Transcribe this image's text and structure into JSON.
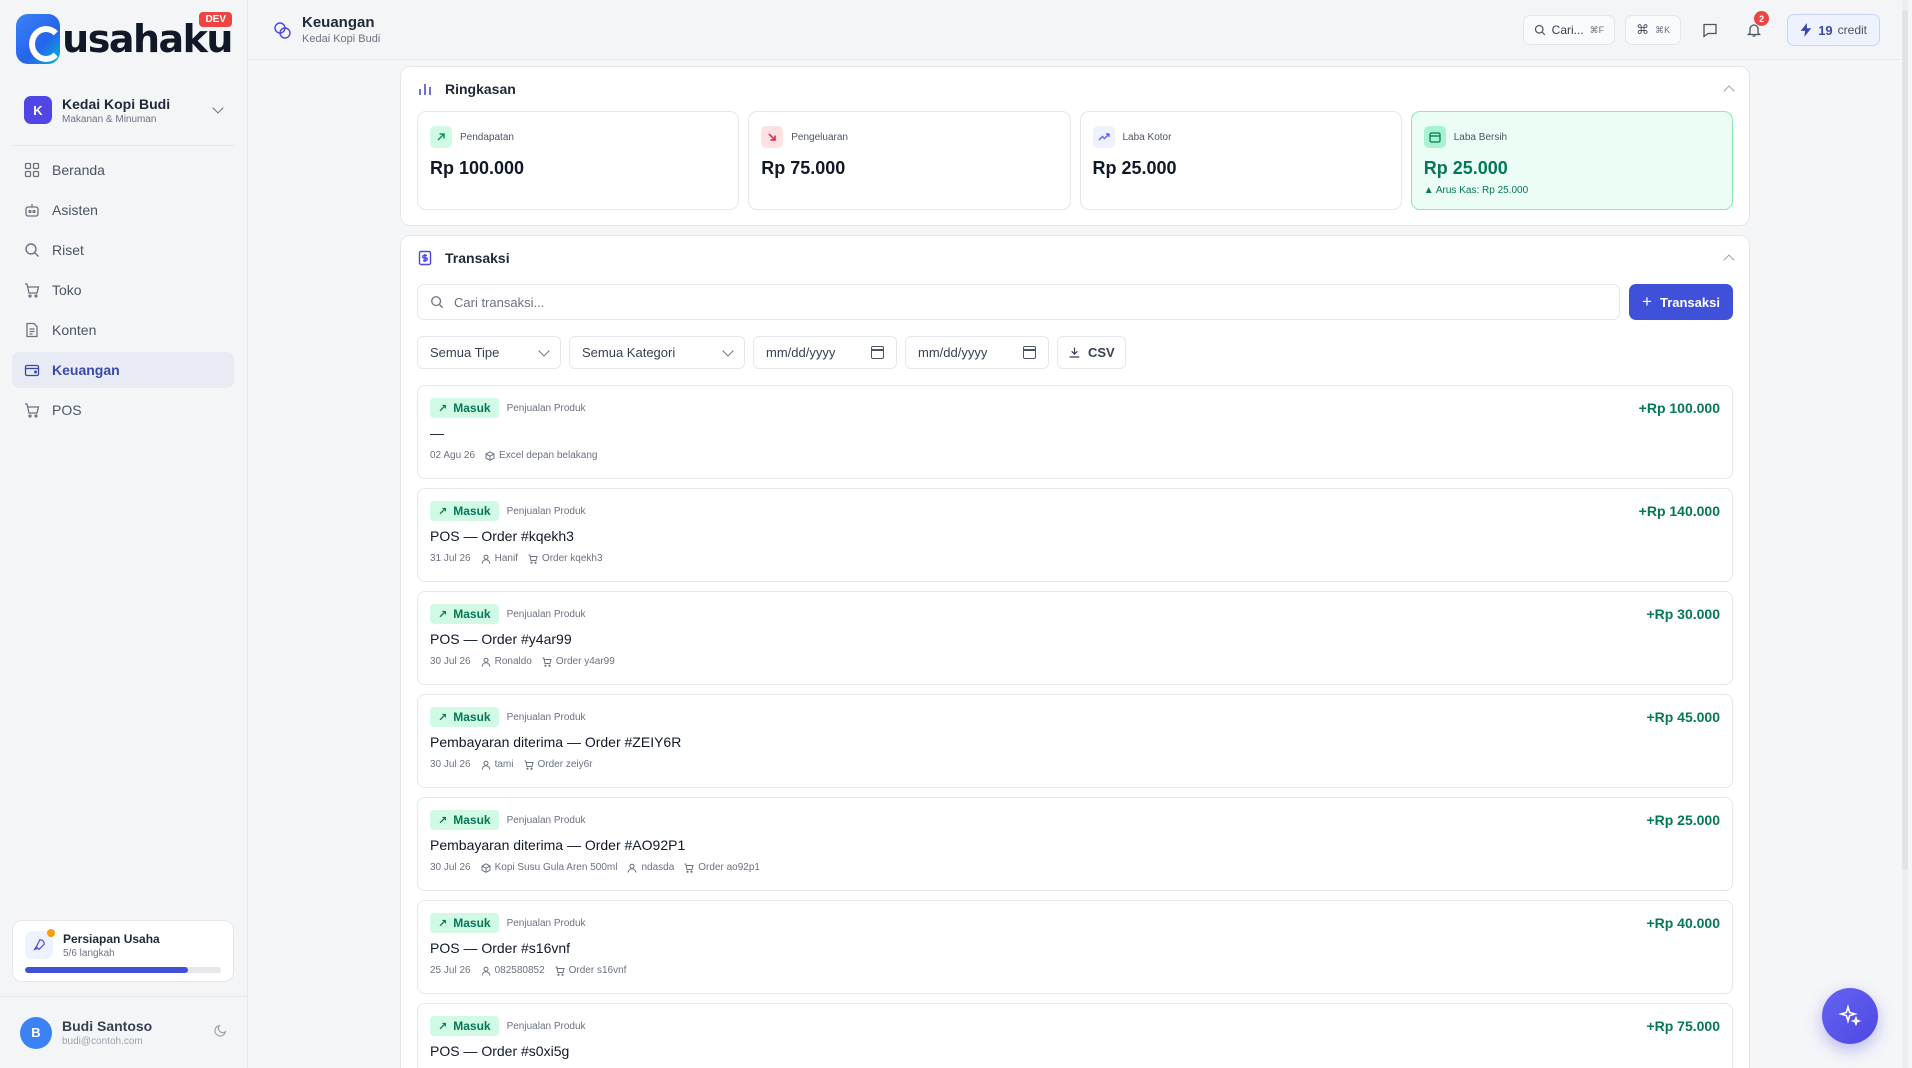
{
  "brand": {
    "name": "usahaku",
    "badge": "DEV"
  },
  "workspace": {
    "initial": "K",
    "name": "Kedai Kopi Budi",
    "category": "Makanan & Minuman"
  },
  "nav": [
    {
      "label": "Beranda",
      "icon": "dashboard-icon"
    },
    {
      "label": "Asisten",
      "icon": "bot-icon"
    },
    {
      "label": "Riset",
      "icon": "search-icon"
    },
    {
      "label": "Toko",
      "icon": "cart-icon"
    },
    {
      "label": "Konten",
      "icon": "document-icon"
    },
    {
      "label": "Keuangan",
      "icon": "wallet-icon",
      "active": true
    },
    {
      "label": "POS",
      "icon": "cart-icon"
    }
  ],
  "setup": {
    "title": "Persiapan Usaha",
    "steps": "5/6 langkah",
    "progress": 0.83
  },
  "user": {
    "initial": "B",
    "name": "Budi Santoso",
    "email": "budi@contoh.com"
  },
  "header": {
    "title": "Keuangan",
    "subtitle": "Kedai Kopi Budi"
  },
  "topbar": {
    "search_label": "Cari...",
    "search_kbd": "⌘F",
    "cmd_kbd": "⌘K",
    "notif_count": "2",
    "credit_count": "19",
    "credit_label": "credit"
  },
  "summary": {
    "title": "Ringkasan",
    "cards": [
      {
        "label": "Pendapatan",
        "value": "Rp 100.000"
      },
      {
        "label": "Pengeluaran",
        "value": "Rp 75.000"
      },
      {
        "label": "Laba Kotor",
        "value": "Rp 25.000"
      },
      {
        "label": "Laba Bersih",
        "value": "Rp 25.000",
        "note": "▲ Arus Kas: Rp 25.000"
      }
    ]
  },
  "transactions": {
    "title": "Transaksi",
    "search_placeholder": "Cari transaksi...",
    "add_label": "Transaksi",
    "filters": {
      "type": "Semua Tipe",
      "category": "Semua Kategori",
      "date_from": "mm/dd/yyyy",
      "date_to": "mm/dd/yyyy",
      "export": "CSV"
    },
    "items": [
      {
        "badge": "Masuk",
        "category": "Penjualan Produk",
        "title": "—",
        "amount": "+Rp 100.000",
        "date": "02 Agu 26",
        "meta": [
          {
            "icon": "box-icon",
            "text": "Excel depan belakang"
          }
        ]
      },
      {
        "badge": "Masuk",
        "category": "Penjualan Produk",
        "title": "POS — Order #kqekh3",
        "amount": "+Rp 140.000",
        "date": "31 Jul 26",
        "meta": [
          {
            "icon": "user-icon",
            "text": "Hanif"
          },
          {
            "icon": "cart-icon",
            "text": "Order kqekh3"
          }
        ]
      },
      {
        "badge": "Masuk",
        "category": "Penjualan Produk",
        "title": "POS — Order #y4ar99",
        "amount": "+Rp 30.000",
        "date": "30 Jul 26",
        "meta": [
          {
            "icon": "user-icon",
            "text": "Ronaldo"
          },
          {
            "icon": "cart-icon",
            "text": "Order y4ar99"
          }
        ]
      },
      {
        "badge": "Masuk",
        "category": "Penjualan Produk",
        "title": "Pembayaran diterima — Order #ZEIY6R",
        "amount": "+Rp 45.000",
        "date": "30 Jul 26",
        "meta": [
          {
            "icon": "user-icon",
            "text": "tami"
          },
          {
            "icon": "cart-icon",
            "text": "Order zeiy6r"
          }
        ]
      },
      {
        "badge": "Masuk",
        "category": "Penjualan Produk",
        "title": "Pembayaran diterima — Order #AO92P1",
        "amount": "+Rp 25.000",
        "date": "30 Jul 26",
        "meta": [
          {
            "icon": "box-icon",
            "text": "Kopi Susu Gula Aren 500ml"
          },
          {
            "icon": "user-icon",
            "text": "ndasda"
          },
          {
            "icon": "cart-icon",
            "text": "Order ao92p1"
          }
        ]
      },
      {
        "badge": "Masuk",
        "category": "Penjualan Produk",
        "title": "POS — Order #s16vnf",
        "amount": "+Rp 40.000",
        "date": "25 Jul 26",
        "meta": [
          {
            "icon": "user-icon",
            "text": "082580852"
          },
          {
            "icon": "cart-icon",
            "text": "Order s16vnf"
          }
        ]
      },
      {
        "badge": "Masuk",
        "category": "Penjualan Produk",
        "title": "POS — Order #s0xi5g",
        "amount": "+Rp 75.000",
        "date": "",
        "meta": []
      }
    ]
  },
  "colors": {
    "accent": "#3f51d8",
    "income": "#047857",
    "income_bg": "#d1fae5",
    "danger": "#ef4444"
  }
}
